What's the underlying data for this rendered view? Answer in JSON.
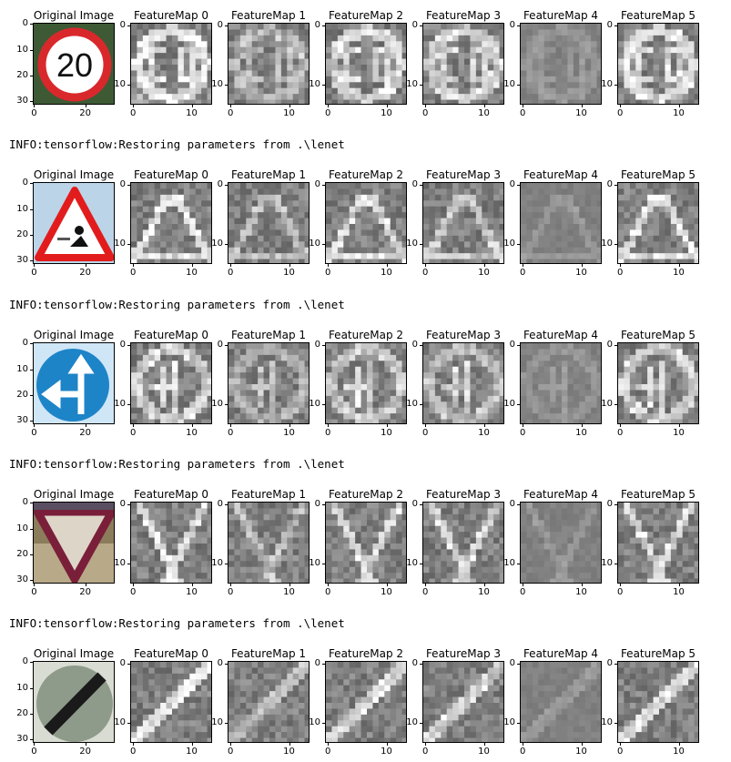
{
  "log_line": "INFO:tensorflow:Restoring parameters from .\\lenet",
  "panel_titles": [
    "Original Image",
    "FeatureMap 0",
    "FeatureMap 1",
    "FeatureMap 2",
    "FeatureMap 3",
    "FeatureMap 4",
    "FeatureMap 5"
  ],
  "original_ticks": {
    "x": [
      "0",
      "20"
    ],
    "y": [
      "0",
      "10",
      "20",
      "30"
    ]
  },
  "feature_ticks": {
    "x": [
      "0",
      "10"
    ],
    "y": [
      "0",
      "10"
    ]
  },
  "rows": [
    {
      "sign": "speed-limit-20",
      "sign_text": "20"
    },
    {
      "sign": "road-work"
    },
    {
      "sign": "go-straight-or-left"
    },
    {
      "sign": "yield"
    },
    {
      "sign": "end-of-all-limits"
    }
  ]
}
